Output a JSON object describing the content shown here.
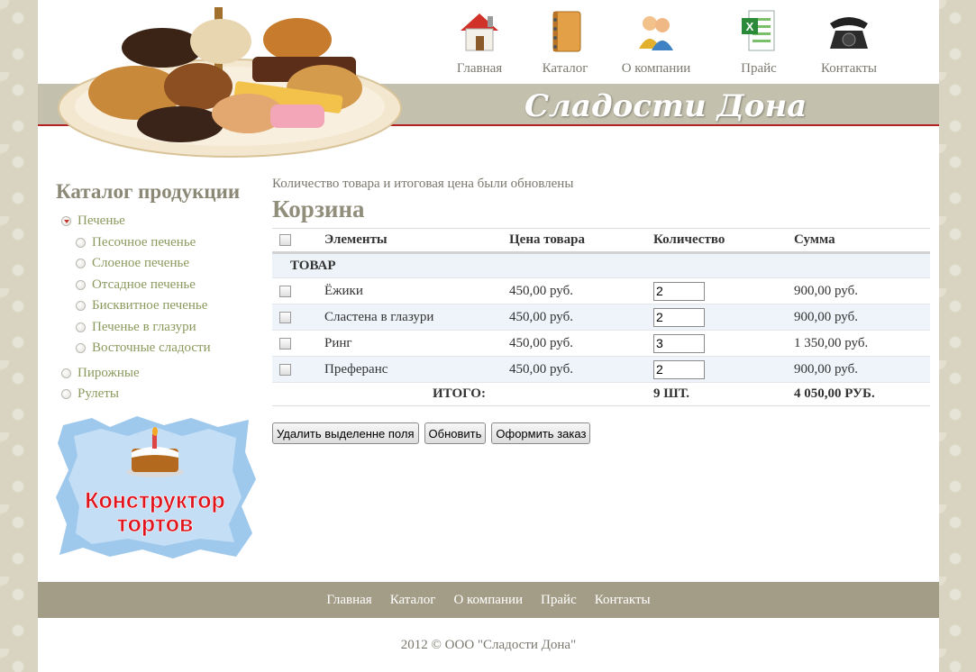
{
  "header": {
    "site_title": "Сладости Дона",
    "nav": [
      {
        "label": "Главная",
        "icon": "house-icon"
      },
      {
        "label": "Каталог",
        "icon": "notebook-icon"
      },
      {
        "label": "О компании",
        "icon": "people-icon"
      },
      {
        "label": "Прайс",
        "icon": "excel-icon"
      },
      {
        "label": "Контакты",
        "icon": "telephone-icon"
      }
    ]
  },
  "sidebar": {
    "title": "Каталог продукции",
    "categories": [
      {
        "label": "Печенье",
        "expanded": true
      },
      {
        "label": "Песочное печенье"
      },
      {
        "label": "Слоеное печенье"
      },
      {
        "label": "Отсадное печенье"
      },
      {
        "label": "Бисквитное печенье"
      },
      {
        "label": "Печенье в глазури"
      },
      {
        "label": "Восточные сладости"
      },
      {
        "label": "Пирожные"
      },
      {
        "label": "Рулеты"
      }
    ],
    "promo": {
      "line1": "Конструктор",
      "line2": "тортов"
    }
  },
  "main": {
    "notice": "Количество товара и итоговая цена были обновлены",
    "title": "Корзина",
    "columns": [
      "Элементы",
      "Цена товара",
      "Количество",
      "Сумма"
    ],
    "group": "ТОВАР",
    "rows": [
      {
        "name": "Ёжики",
        "price": "450,00 руб.",
        "qty": "2",
        "sum": "900,00 руб."
      },
      {
        "name": "Сластена в глазури",
        "price": "450,00 руб.",
        "qty": "2",
        "sum": "900,00 руб."
      },
      {
        "name": "Ринг",
        "price": "450,00 руб.",
        "qty": "3",
        "sum": "1 350,00 руб."
      },
      {
        "name": "Преферанс",
        "price": "450,00 руб.",
        "qty": "2",
        "sum": "900,00 руб."
      }
    ],
    "total": {
      "label": "ИТОГО:",
      "qty": "9 ШТ.",
      "sum": "4 050,00 РУБ."
    },
    "buttons": {
      "delete": "Удалить выделенне поля",
      "update": "Обновить",
      "checkout": "Оформить заказ"
    }
  },
  "footer": {
    "nav": [
      "Главная",
      "Каталог",
      "О компании",
      "Прайс",
      "Контакты"
    ],
    "copyright": "2012 © ООО \"Сладости Дона\""
  },
  "colors": {
    "header_band": "#c3c0ad",
    "accent_line": "#b22222",
    "footer_band": "#a39d87",
    "link_green": "#8a9a5e"
  }
}
